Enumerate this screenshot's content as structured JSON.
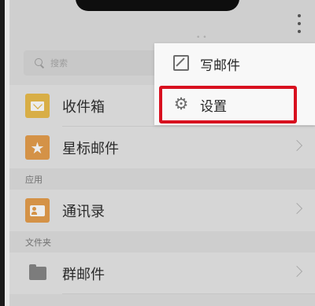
{
  "search": {
    "placeholder": "搜索"
  },
  "list": {
    "inbox": "收件箱",
    "starred": "星标邮件",
    "contacts": "通讯录",
    "group_mail": "群邮件"
  },
  "sections": {
    "apps": "应用",
    "folders": "文件夹"
  },
  "menu": {
    "compose": "写邮件",
    "settings": "设置"
  },
  "colors": {
    "inbox_icon": "#e8b73e",
    "starred_icon": "#e4973f",
    "contacts_icon": "#e4973f",
    "highlight": "#d8101f"
  },
  "icons": {
    "more": "more-vertical-icon",
    "search": "search-icon",
    "inbox": "envelope-icon",
    "starred": "star-icon",
    "contacts": "contact-card-icon",
    "group_mail": "folder-icon",
    "compose": "compose-icon",
    "settings": "gear-icon"
  }
}
